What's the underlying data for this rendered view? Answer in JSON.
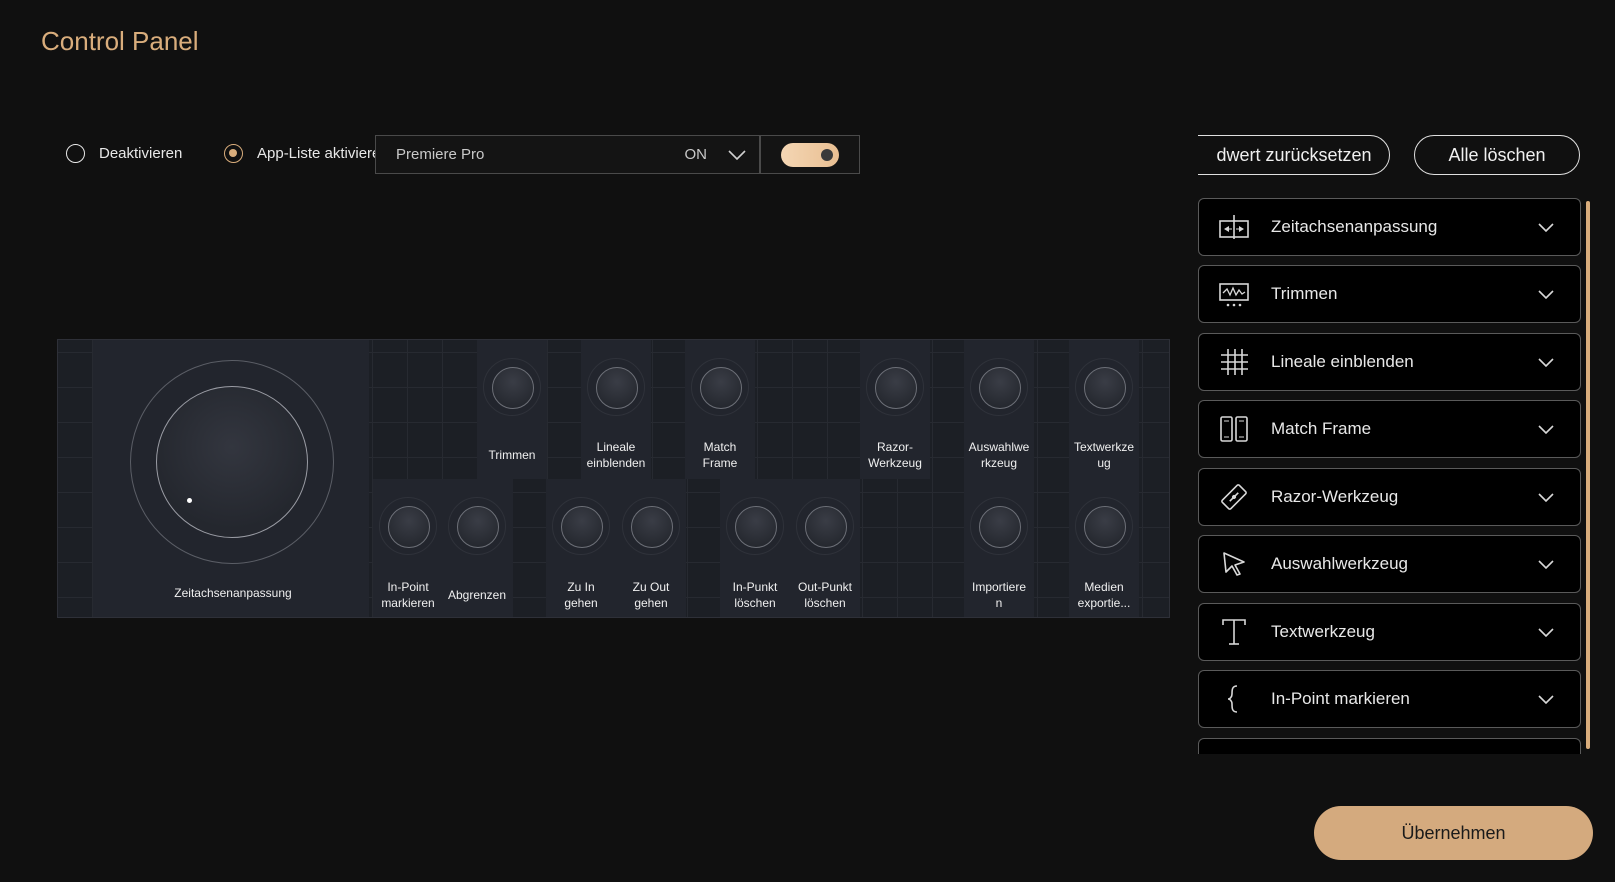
{
  "window": {
    "title": "Control Panel"
  },
  "mode": {
    "deactivate_label": "Deaktivieren",
    "applist_label": "App-Liste aktivieren",
    "selected": "applist"
  },
  "app_select": {
    "value": "Premiere Pro",
    "state": "ON"
  },
  "toggle": {
    "on": true
  },
  "buttons": {
    "reset_label": "dwert zurücksetzen",
    "clear_label": "Alle löschen",
    "apply_label": "Übernehmen"
  },
  "device": {
    "dial_label": "Zeitachsenanpassung",
    "top_row": [
      {
        "label": "Trimmen"
      },
      {
        "label": "Lineale\neinblenden"
      },
      {
        "label": "Match\nFrame"
      },
      {
        "label": "Razor-\nWerkzeug"
      },
      {
        "label": "Auswahlwe\nrkzeug"
      },
      {
        "label": "Textwerkze\nug"
      }
    ],
    "bottom_row": [
      {
        "label": "In-Point\nmarkieren"
      },
      {
        "label": "Abgrenzen"
      },
      {
        "label": "Zu In\ngehen"
      },
      {
        "label": "Zu Out\ngehen"
      },
      {
        "label": "In-Punkt\nlöschen"
      },
      {
        "label": "Out-Punkt\nlöschen"
      },
      {
        "label": "Importiere\nn"
      },
      {
        "label": "Medien\nexportie..."
      }
    ]
  },
  "function_list": [
    {
      "label": "Zeitachsenanpassung",
      "icon": "timeline-adjust-icon"
    },
    {
      "label": "Trimmen",
      "icon": "waveform-icon"
    },
    {
      "label": "Lineale einblenden",
      "icon": "grid-icon"
    },
    {
      "label": "Match Frame",
      "icon": "match-frame-icon"
    },
    {
      "label": "Razor-Werkzeug",
      "icon": "razor-icon"
    },
    {
      "label": "Auswahlwerkzeug",
      "icon": "cursor-icon"
    },
    {
      "label": "Textwerkzeug",
      "icon": "text-tool-icon"
    },
    {
      "label": "In-Point markieren",
      "icon": "brace-icon"
    }
  ],
  "colors": {
    "accent": "#d9ad7c",
    "background": "#101010"
  }
}
